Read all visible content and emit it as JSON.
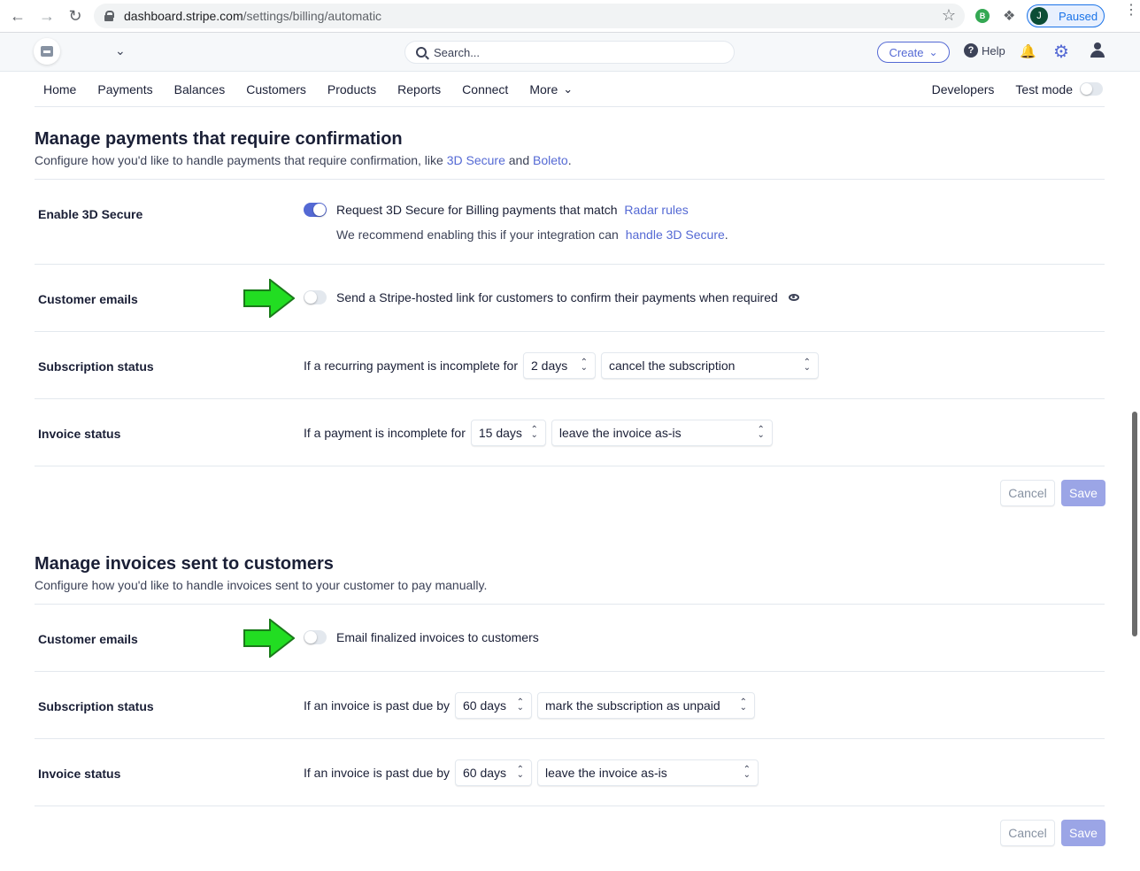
{
  "browser": {
    "url_host": "dashboard.stripe.com",
    "url_path": "/settings/billing/automatic",
    "extension_badge": "B",
    "profile_initial": "J",
    "profile_status": "Paused"
  },
  "header": {
    "search_placeholder": "Search...",
    "create_label": "Create",
    "help_label": "Help"
  },
  "nav": {
    "items": [
      "Home",
      "Payments",
      "Balances",
      "Customers",
      "Products",
      "Reports",
      "Connect",
      "More"
    ],
    "developers": "Developers",
    "test_mode": "Test mode",
    "test_mode_enabled": false
  },
  "section1": {
    "title": "Manage payments that require confirmation",
    "desc_prefix": "Configure how you'd like to handle payments that require confirmation, like ",
    "link1": "3D Secure",
    "desc_and": " and ",
    "link2": "Boleto",
    "desc_end": ".",
    "rows": {
      "secure": {
        "label": "Enable 3D Secure",
        "enabled": true,
        "text": "Request 3D Secure for Billing payments that match ",
        "link": "Radar rules",
        "sub_text": "We recommend enabling this if your integration can ",
        "sub_link": "handle 3D Secure",
        "sub_end": "."
      },
      "emails": {
        "label": "Customer emails",
        "enabled": false,
        "text": "Send a Stripe-hosted link for customers to confirm their payments when required"
      },
      "subscription": {
        "label": "Subscription status",
        "text": "If a recurring payment is incomplete for",
        "days": "2 days",
        "action": "cancel the subscription"
      },
      "invoice": {
        "label": "Invoice status",
        "text": "If a payment is incomplete for",
        "days": "15 days",
        "action": "leave the invoice as-is"
      }
    },
    "cancel": "Cancel",
    "save": "Save"
  },
  "section2": {
    "title": "Manage invoices sent to customers",
    "desc": "Configure how you'd like to handle invoices sent to your customer to pay manually.",
    "rows": {
      "emails": {
        "label": "Customer emails",
        "enabled": false,
        "text": "Email finalized invoices to customers"
      },
      "subscription": {
        "label": "Subscription status",
        "text": "If an invoice is past due by",
        "days": "60 days",
        "action": "mark the subscription as unpaid"
      },
      "invoice": {
        "label": "Invoice status",
        "text": "If an invoice is past due by",
        "days": "60 days",
        "action": "leave the invoice as-is"
      }
    },
    "cancel": "Cancel",
    "save": "Save"
  },
  "colors": {
    "accent": "#5469d4",
    "annotation_arrow": "#22dd22"
  }
}
